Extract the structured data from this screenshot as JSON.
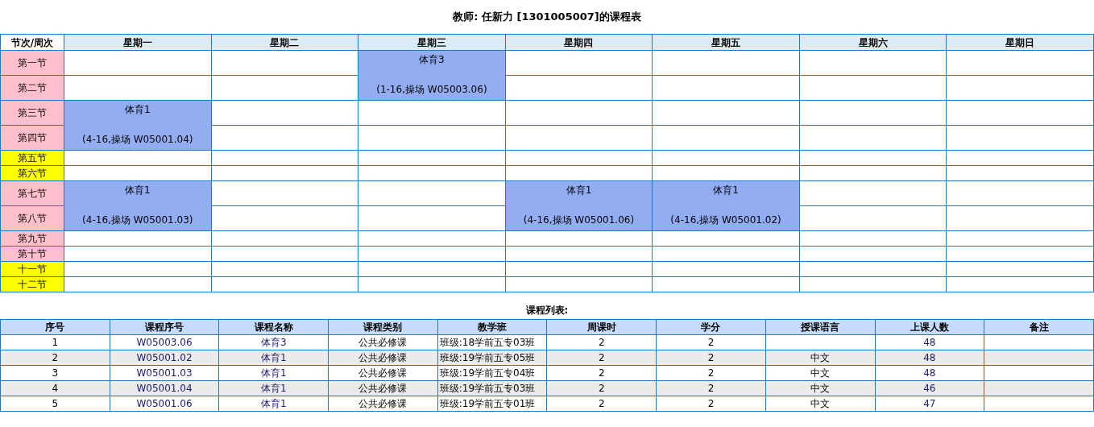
{
  "title": "教师: 任新力 [1301005007]的课程表",
  "timetable": {
    "corner": "节次/周次",
    "days": [
      "星期一",
      "星期二",
      "星期三",
      "星期四",
      "星期五",
      "星期六",
      "星期日"
    ],
    "rows": [
      {
        "period": "第一节",
        "color": "#ffc0cb",
        "tall": true,
        "cells": [
          {
            "kind": "empty"
          },
          {
            "kind": "empty"
          },
          {
            "kind": "course",
            "name": "体育3",
            "detail": "(1-16,操场 W05003.06)"
          },
          {
            "kind": "empty"
          },
          {
            "kind": "empty"
          },
          {
            "kind": "empty"
          },
          {
            "kind": "empty"
          }
        ]
      },
      {
        "period": "第二节",
        "color": "#ffc0cb",
        "tall": true,
        "cells": [
          {
            "kind": "empty"
          },
          {
            "kind": "empty"
          },
          {
            "kind": "covered"
          },
          {
            "kind": "empty"
          },
          {
            "kind": "empty"
          },
          {
            "kind": "empty"
          },
          {
            "kind": "empty"
          }
        ]
      },
      {
        "period": "第三节",
        "color": "#ffc0cb",
        "tall": true,
        "cells": [
          {
            "kind": "course",
            "name": "体育1",
            "detail": "(4-16,操场 W05001.04)"
          },
          {
            "kind": "empty"
          },
          {
            "kind": "empty"
          },
          {
            "kind": "empty"
          },
          {
            "kind": "empty"
          },
          {
            "kind": "empty"
          },
          {
            "kind": "empty"
          }
        ]
      },
      {
        "period": "第四节",
        "color": "#ffc0cb",
        "tall": true,
        "cells": [
          {
            "kind": "covered"
          },
          {
            "kind": "empty"
          },
          {
            "kind": "empty"
          },
          {
            "kind": "empty"
          },
          {
            "kind": "empty"
          },
          {
            "kind": "empty"
          },
          {
            "kind": "empty"
          }
        ]
      },
      {
        "period": "第五节",
        "color": "#ffff00",
        "tall": false,
        "cells": [
          {
            "kind": "empty"
          },
          {
            "kind": "empty"
          },
          {
            "kind": "empty"
          },
          {
            "kind": "empty"
          },
          {
            "kind": "empty"
          },
          {
            "kind": "empty"
          },
          {
            "kind": "empty"
          }
        ]
      },
      {
        "period": "第六节",
        "color": "#ffff00",
        "tall": false,
        "cells": [
          {
            "kind": "empty"
          },
          {
            "kind": "empty"
          },
          {
            "kind": "empty"
          },
          {
            "kind": "empty"
          },
          {
            "kind": "empty"
          },
          {
            "kind": "empty"
          },
          {
            "kind": "empty"
          }
        ]
      },
      {
        "period": "第七节",
        "color": "#ffc0cb",
        "tall": true,
        "cells": [
          {
            "kind": "course",
            "name": "体育1",
            "detail": "(4-16,操场 W05001.03)"
          },
          {
            "kind": "empty"
          },
          {
            "kind": "empty"
          },
          {
            "kind": "course",
            "name": "体育1",
            "detail": "(4-16,操场 W05001.06)"
          },
          {
            "kind": "course",
            "name": "体育1",
            "detail": "(4-16,操场 W05001.02)"
          },
          {
            "kind": "empty"
          },
          {
            "kind": "empty"
          }
        ]
      },
      {
        "period": "第八节",
        "color": "#ffc0cb",
        "tall": true,
        "cells": [
          {
            "kind": "covered"
          },
          {
            "kind": "empty"
          },
          {
            "kind": "empty"
          },
          {
            "kind": "covered"
          },
          {
            "kind": "covered"
          },
          {
            "kind": "empty"
          },
          {
            "kind": "empty"
          }
        ]
      },
      {
        "period": "第九节",
        "color": "#ffc0cb",
        "tall": false,
        "cells": [
          {
            "kind": "empty"
          },
          {
            "kind": "empty"
          },
          {
            "kind": "empty"
          },
          {
            "kind": "empty"
          },
          {
            "kind": "empty"
          },
          {
            "kind": "empty"
          },
          {
            "kind": "empty"
          }
        ]
      },
      {
        "period": "第十节",
        "color": "#ffc0cb",
        "tall": false,
        "cells": [
          {
            "kind": "empty"
          },
          {
            "kind": "empty"
          },
          {
            "kind": "empty"
          },
          {
            "kind": "empty"
          },
          {
            "kind": "empty"
          },
          {
            "kind": "empty"
          },
          {
            "kind": "empty"
          }
        ]
      },
      {
        "period": "十一节",
        "color": "#ffff00",
        "tall": false,
        "cells": [
          {
            "kind": "empty"
          },
          {
            "kind": "empty"
          },
          {
            "kind": "empty"
          },
          {
            "kind": "empty"
          },
          {
            "kind": "empty"
          },
          {
            "kind": "empty"
          },
          {
            "kind": "empty"
          }
        ]
      },
      {
        "period": "十二节",
        "color": "#ffff00",
        "tall": false,
        "cells": [
          {
            "kind": "empty"
          },
          {
            "kind": "empty"
          },
          {
            "kind": "empty"
          },
          {
            "kind": "empty"
          },
          {
            "kind": "empty"
          },
          {
            "kind": "empty"
          },
          {
            "kind": "empty"
          }
        ]
      }
    ]
  },
  "course_list": {
    "title": "课程列表:",
    "columns": [
      {
        "label": "序号",
        "link": false
      },
      {
        "label": "课程序号",
        "link": true
      },
      {
        "label": "课程名称",
        "link": true
      },
      {
        "label": "课程类别",
        "link": false
      },
      {
        "label": "教学班",
        "link": false
      },
      {
        "label": "周课时",
        "link": false
      },
      {
        "label": "学分",
        "link": false
      },
      {
        "label": "授课语言",
        "link": false
      },
      {
        "label": "上课人数",
        "link": true
      },
      {
        "label": "备注"
      }
    ],
    "rows": [
      [
        "1",
        "W05003.06",
        "体育3",
        "公共必修课",
        "班级:18学前五专03班",
        "2",
        "2",
        "",
        "48",
        ""
      ],
      [
        "2",
        "W05001.02",
        "体育1",
        "公共必修课",
        "班级:19学前五专05班",
        "2",
        "2",
        "中文",
        "48",
        ""
      ],
      [
        "3",
        "W05001.03",
        "体育1",
        "公共必修课",
        "班级:19学前五专04班",
        "2",
        "2",
        "中文",
        "48",
        ""
      ],
      [
        "4",
        "W05001.04",
        "体育1",
        "公共必修课",
        "班级:19学前五专03班",
        "2",
        "2",
        "中文",
        "46",
        ""
      ],
      [
        "5",
        "W05001.06",
        "体育1",
        "公共必修课",
        "班级:19学前五专01班",
        "2",
        "2",
        "中文",
        "47",
        ""
      ]
    ]
  }
}
